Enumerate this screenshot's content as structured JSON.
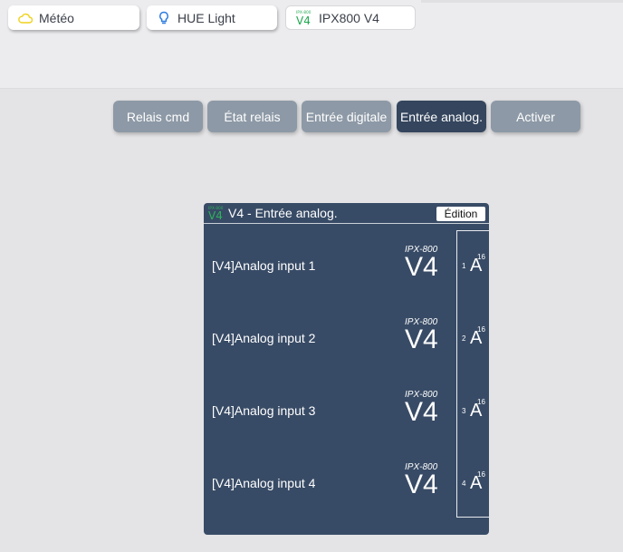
{
  "plugins": {
    "meteo": {
      "label": "Météo",
      "icon": "cloud-icon",
      "icon_color": "#f0d21c"
    },
    "hue": {
      "label": "HUE Light",
      "icon": "lightbulb-icon",
      "icon_color": "#2f7de0"
    },
    "ipx": {
      "label": "IPX800 V4",
      "logo_small": "IPX-800",
      "logo_big": "V4",
      "logo_color": "#1fa84f"
    }
  },
  "toolbar": {
    "relais_cmd": "Relais cmd",
    "etat_relais": "État relais",
    "entree_digitale": "Entrée digitale",
    "entree_analog": "Entrée analog.",
    "activer": "Activer",
    "active_color": "#34455d",
    "inactive_color": "#8d99a6"
  },
  "widget": {
    "title": "V4 - Entrée analog.",
    "logo_small": "IPX-800",
    "logo_big": "V4",
    "edit_label": "Édition",
    "rows": [
      {
        "label": "[V4]Analog input 1",
        "brand_small": "IPX-800",
        "brand_big": "V4",
        "index": "1",
        "symbol": "A",
        "sup": "16"
      },
      {
        "label": "[V4]Analog input 2",
        "brand_small": "IPX-800",
        "brand_big": "V4",
        "index": "2",
        "symbol": "A",
        "sup": "16"
      },
      {
        "label": "[V4]Analog input 3",
        "brand_small": "IPX-800",
        "brand_big": "V4",
        "index": "3",
        "symbol": "A",
        "sup": "16"
      },
      {
        "label": "[V4]Analog input 4",
        "brand_small": "IPX-800",
        "brand_big": "V4",
        "index": "4",
        "symbol": "A",
        "sup": "16"
      }
    ]
  }
}
